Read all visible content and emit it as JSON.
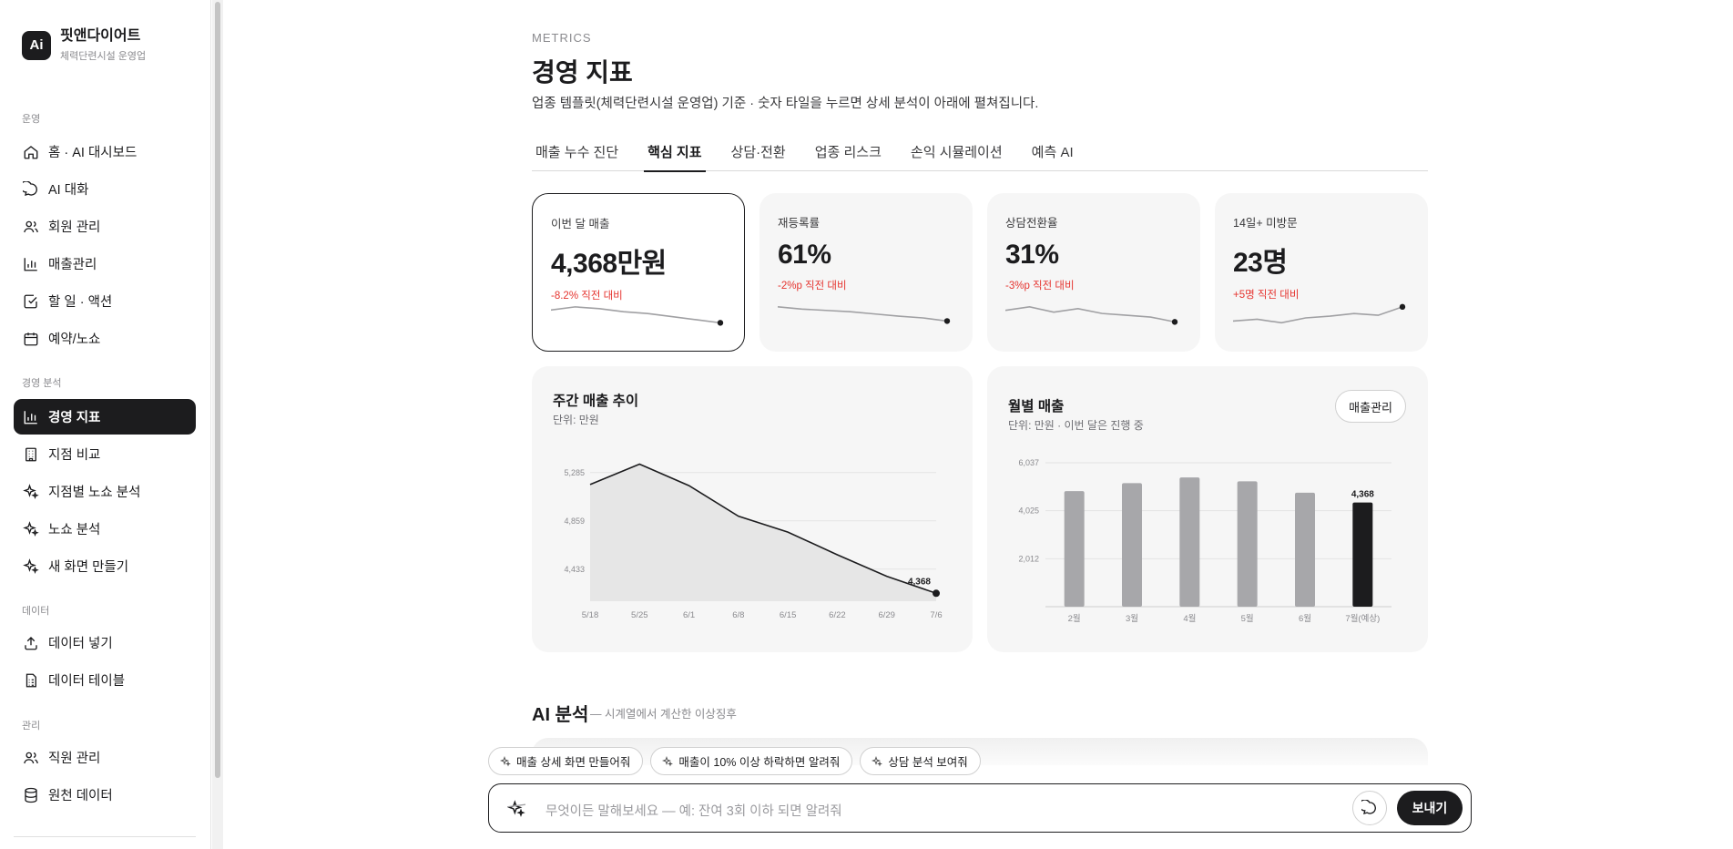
{
  "brand": {
    "logo": "Ai",
    "name": "핏앤다이어트",
    "sub": "체력단련시설 운영업"
  },
  "sidebar": {
    "sections": [
      {
        "label": "운영",
        "items": [
          {
            "label": "홈 · AI 대시보드",
            "icon": "home-icon"
          },
          {
            "label": "AI 대화",
            "icon": "chat-icon"
          },
          {
            "label": "회원 관리",
            "icon": "users-icon"
          },
          {
            "label": "매출관리",
            "icon": "bar-chart-icon"
          },
          {
            "label": "할 일 · 액션",
            "icon": "checkbox-icon"
          },
          {
            "label": "예약/노쇼",
            "icon": "calendar-icon"
          }
        ]
      },
      {
        "label": "경영 분석",
        "items": [
          {
            "label": "경영 지표",
            "icon": "bar-chart-icon",
            "active": true
          },
          {
            "label": "지점 비교",
            "icon": "building-icon"
          },
          {
            "label": "지점별 노쇼 분석",
            "icon": "sparkle-icon"
          },
          {
            "label": "노쇼 분석",
            "icon": "sparkle-icon"
          },
          {
            "label": "새 화면 만들기",
            "icon": "sparkle-icon"
          }
        ]
      },
      {
        "label": "데이터",
        "items": [
          {
            "label": "데이터 넣기",
            "icon": "upload-icon"
          },
          {
            "label": "데이터 테이블",
            "icon": "table-icon"
          }
        ]
      },
      {
        "label": "관리",
        "items": [
          {
            "label": "직원 관리",
            "icon": "users-icon"
          },
          {
            "label": "원천 데이터",
            "icon": "database-icon"
          }
        ]
      }
    ]
  },
  "header": {
    "eyebrow": "METRICS",
    "title": "경영 지표",
    "desc": "업종 템플릿(체력단련시설 운영업) 기준 · 숫자 타일을 누르면 상세 분석이 아래에 펼쳐집니다."
  },
  "tabs": [
    {
      "label": "매출 누수 진단"
    },
    {
      "label": "핵심 지표",
      "active": true
    },
    {
      "label": "상담·전환"
    },
    {
      "label": "업종 리스크"
    },
    {
      "label": "손익 시뮬레이션"
    },
    {
      "label": "예측 AI"
    }
  ],
  "tiles": [
    {
      "label": "이번 달 매출",
      "value": "4,368만원",
      "delta": "-8.2% 직전 대비",
      "spark": [
        5.5,
        6.2,
        5.8,
        5.1,
        4.7,
        4.0,
        3.3,
        2.6
      ],
      "selected": true
    },
    {
      "label": "재등록률",
      "value": "61%",
      "delta": "-2%p 직전 대비",
      "spark": [
        6.0,
        5.5,
        5.2,
        4.9,
        4.4,
        3.9,
        3.5,
        2.8
      ]
    },
    {
      "label": "상담전환율",
      "value": "31%",
      "delta": "-3%p 직전 대비",
      "spark": [
        5.2,
        6.0,
        4.8,
        5.6,
        4.5,
        4.1,
        3.7,
        2.6
      ]
    },
    {
      "label": "14일+ 미방문",
      "value": "23명",
      "delta": "+5명 직전 대비",
      "spark": [
        2.8,
        3.2,
        2.4,
        3.5,
        3.9,
        4.5,
        4.1,
        6.0
      ]
    }
  ],
  "chart_data": [
    {
      "type": "line",
      "title": "주간 매출 추이",
      "subtitle": "단위: 만원",
      "x": [
        "5/18",
        "5/25",
        "6/1",
        "6/8",
        "6/15",
        "6/22",
        "6/29",
        "7/6"
      ],
      "values": [
        5180,
        5360,
        5170,
        4900,
        4760,
        4560,
        4370,
        4220
      ],
      "yticks": [
        5285,
        4859,
        4433
      ],
      "ylim": [
        4150,
        5420
      ],
      "annotation": "4,368",
      "grid": true
    },
    {
      "type": "bar",
      "title": "월별 매출",
      "subtitle": "단위: 만원 · 이번 달은 진행 중",
      "categories": [
        "2월",
        "3월",
        "4월",
        "5월",
        "6월",
        "7월(예상)"
      ],
      "values": [
        4850,
        5180,
        5420,
        5260,
        4780,
        4368
      ],
      "yticks": [
        6037,
        4025,
        2012
      ],
      "ylim": [
        0,
        6037
      ],
      "annotation": "4,368",
      "grid": true,
      "highlight_color": "#1c1c1e",
      "bar_color": "#a7a7aa"
    }
  ],
  "revenue_button": "매출관리",
  "ai": {
    "title": "AI 분석",
    "sub": "— 시계열에서 계산한 이상징후"
  },
  "chips": [
    "매출 상세 화면 만들어줘",
    "매출이 10% 이상 하락하면 알려줘",
    "상담 분석 보여줘"
  ],
  "composer": {
    "placeholder": "무엇이든 말해보세요 — 예: 잔여 3회 이하 되면 알려줘",
    "send": "보내기"
  },
  "colors": {
    "accent": "#1c1c1e",
    "negative": "#e5342f",
    "panel": "#f6f6f6"
  }
}
